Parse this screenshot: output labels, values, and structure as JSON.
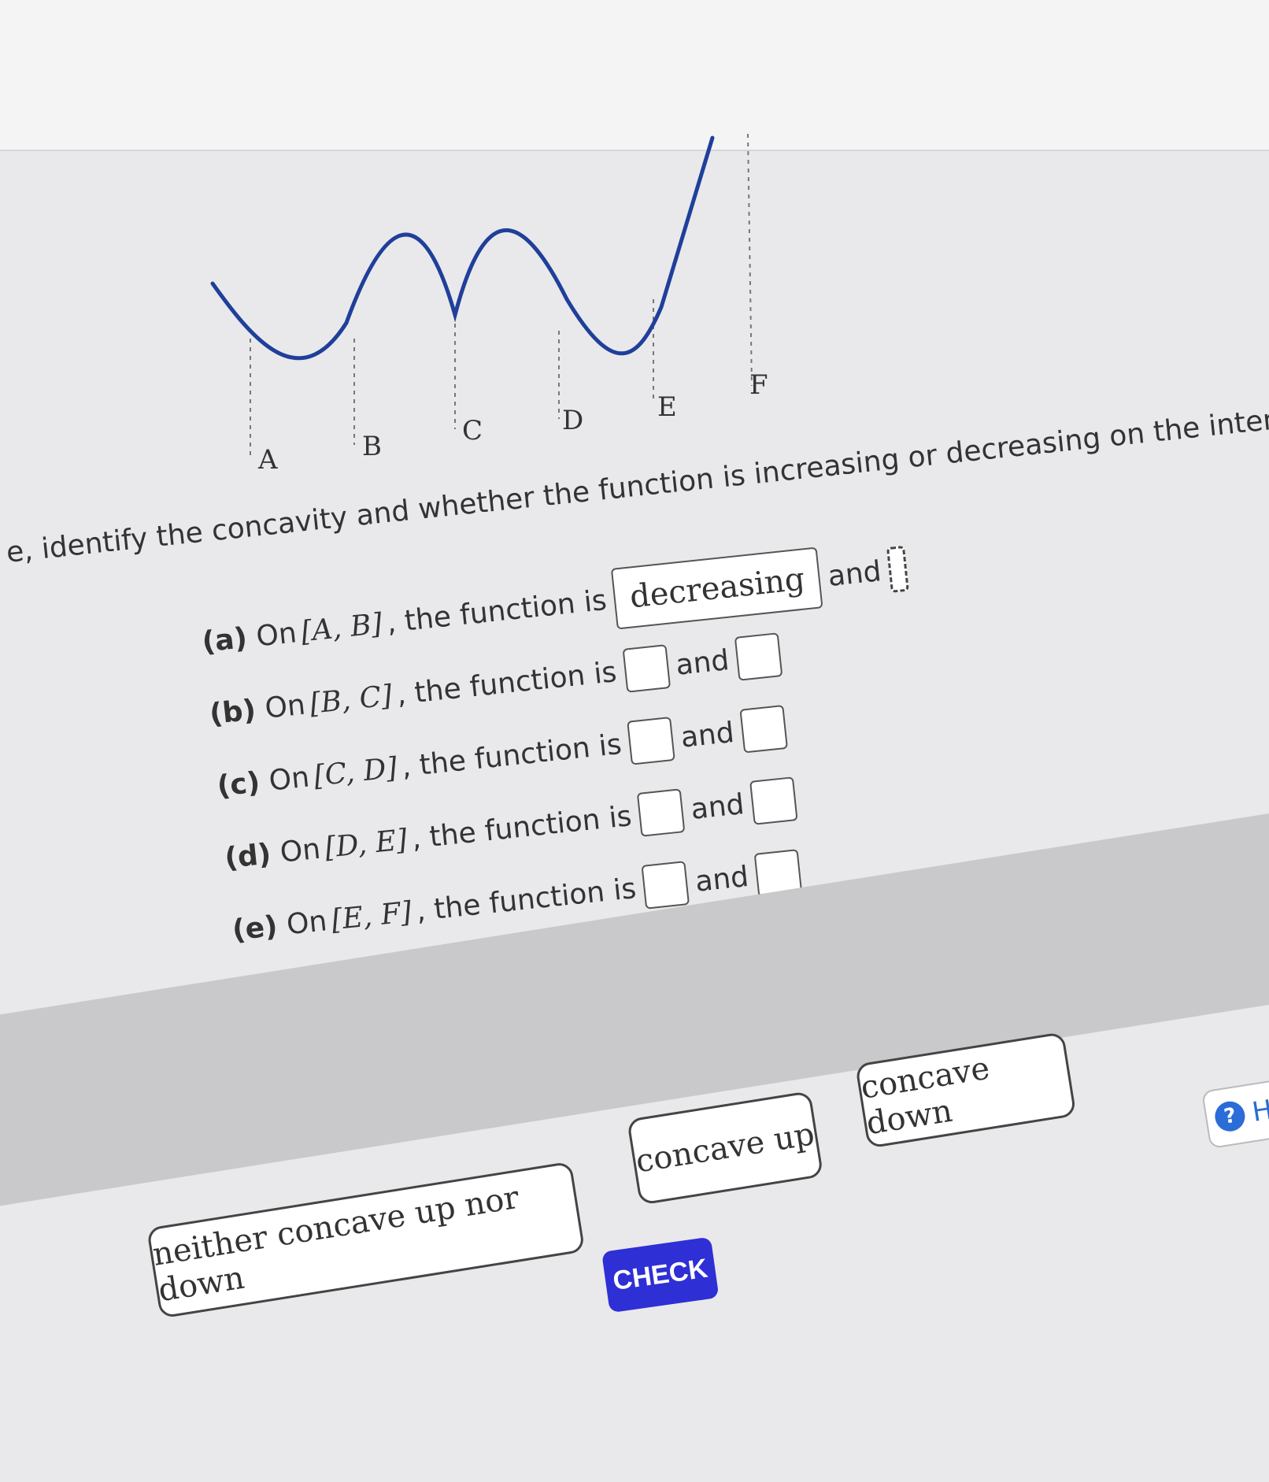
{
  "graph": {
    "points": [
      "A",
      "B",
      "C",
      "D",
      "E",
      "F"
    ]
  },
  "prompt": {
    "text": "e, identify the concavity and whether the function is increasing or decreasing on the intervals indicated b"
  },
  "questions": [
    {
      "letter": "(a)",
      "prefix": "On",
      "interval": "[A, B]",
      "middle": ", the function is",
      "answer": "decreasing",
      "and": "and"
    },
    {
      "letter": "(b)",
      "prefix": "On",
      "interval": "[B, C]",
      "middle": ", the function is",
      "answer": "",
      "and": "and"
    },
    {
      "letter": "(c)",
      "prefix": "On",
      "interval": "[C, D]",
      "middle": ", the function is",
      "answer": "",
      "and": "and"
    },
    {
      "letter": "(d)",
      "prefix": "On",
      "interval": "[D, E]",
      "middle": ", the function is",
      "answer": "",
      "and": "and"
    },
    {
      "letter": "(e)",
      "prefix": "On",
      "interval": "[E, F]",
      "middle": ", the function is",
      "answer": "",
      "and": "and"
    }
  ],
  "choices": {
    "neither": "neither concave up nor down",
    "up": "concave up",
    "down": "concave down"
  },
  "check_label": "CHECK",
  "help": {
    "icon": "question-icon",
    "label": "H"
  },
  "colors": {
    "check": "#2f2fd6",
    "help": "#2a6cd8",
    "curve": "#1f3f9a"
  }
}
